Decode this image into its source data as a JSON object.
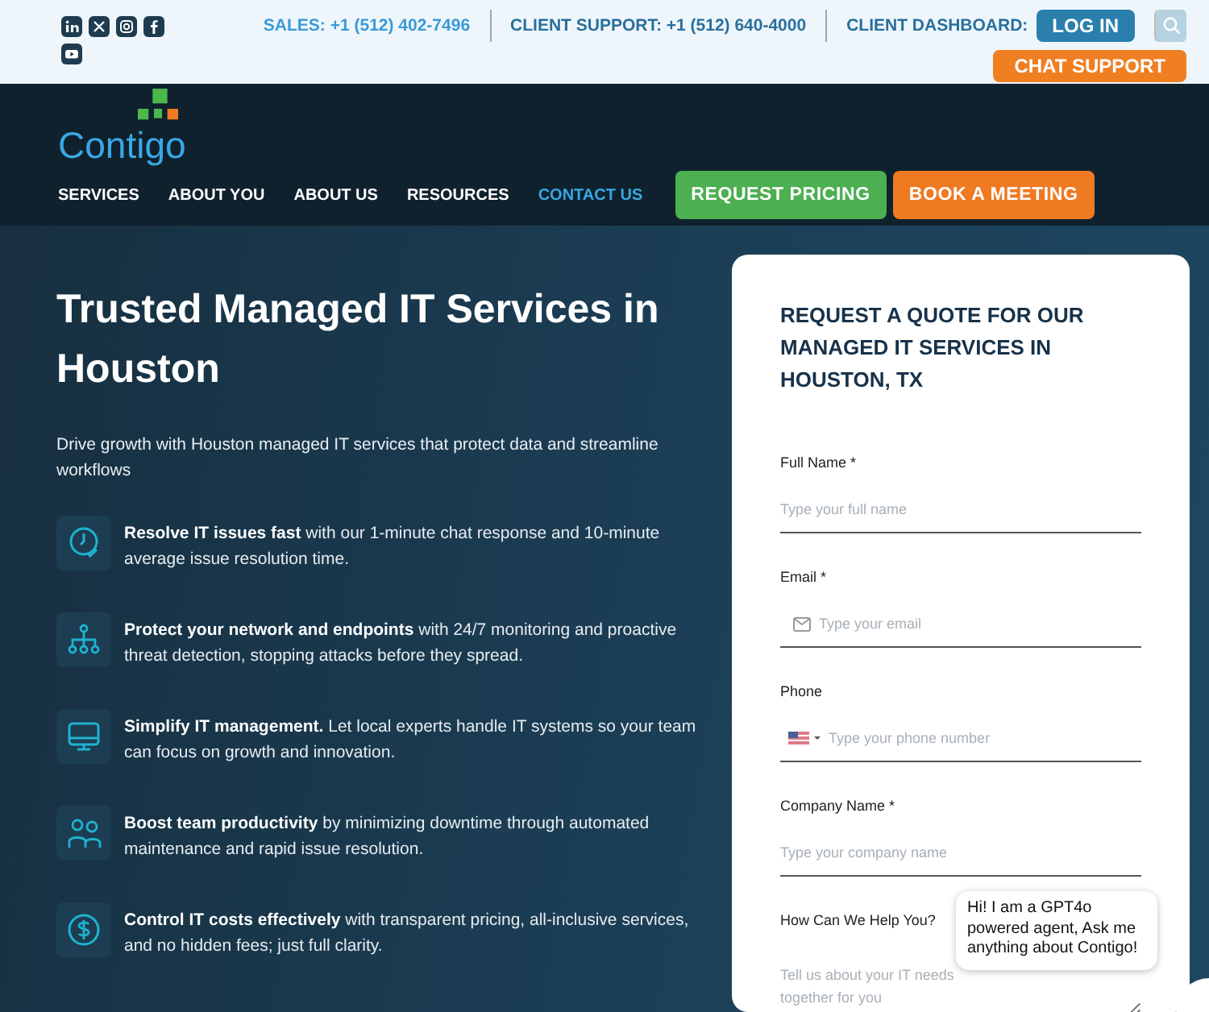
{
  "topbar": {
    "social_icons": [
      {
        "kind": "linkedin"
      },
      {
        "kind": "x"
      },
      {
        "kind": "instagram"
      },
      {
        "kind": "facebook"
      },
      {
        "kind": "youtube"
      }
    ],
    "contacts": [
      {
        "text": "SALES: +1 (512) 402-7496",
        "kind": "sales"
      },
      {
        "text": "CLIENT SUPPORT: +1 (512) 640-4000",
        "kind": "support"
      }
    ],
    "dashboard_label": "CLIENT DASHBOARD:",
    "login_button": "LOG IN",
    "chat_support_button": "CHAT SUPPORT"
  },
  "nav": {
    "logo": "Contigo",
    "items": [
      {
        "label": "SERVICES",
        "selected": false
      },
      {
        "label": "ABOUT YOU",
        "selected": false
      },
      {
        "label": "ABOUT US",
        "selected": false
      },
      {
        "label": "RESOURCES",
        "selected": false
      },
      {
        "label": "CONTACT US",
        "selected": true
      }
    ],
    "buttons": [
      {
        "label": "REQUEST PRICING",
        "kind": "green"
      },
      {
        "label": "BOOK A MEETING",
        "kind": "orange"
      }
    ]
  },
  "hero": {
    "title": "Trusted Managed IT Services in Houston",
    "subtitle": "Drive growth with Houston managed IT services that protect data and streamline workflows",
    "features": [
      {
        "kind": "clock",
        "text": "**Resolve IT issues fast** with our 1-minute chat response and 10-minute average issue resolution time."
      },
      {
        "kind": "network",
        "text": "**Protect your network and endpoints** with 24/7 monitoring and proactive threat detection, stopping attacks before they spread."
      },
      {
        "kind": "monitor",
        "text": "**Simplify IT management.** Let local experts handle IT systems so your team can focus on growth and innovation."
      },
      {
        "kind": "team",
        "text": "**Boost team productivity** by minimizing downtime through automated maintenance and rapid issue resolution."
      },
      {
        "kind": "dollar",
        "text": "**Control IT costs effectively** with transparent pricing, all-inclusive services, and no hidden fees; just full clarity."
      }
    ]
  },
  "form": {
    "title": "REQUEST A QUOTE FOR OUR MANAGED IT SERVICES IN HOUSTON, TX",
    "fields": [
      {
        "kind": "text",
        "label": "Full Name *",
        "placeholder": "Type your full name"
      },
      {
        "kind": "email",
        "label": "Email *",
        "placeholder": "Type your email"
      },
      {
        "kind": "phone",
        "label": "Phone",
        "placeholder": "Type your phone number"
      },
      {
        "kind": "text",
        "label": "Company Name *",
        "placeholder": "Type your company name"
      },
      {
        "kind": "textarea",
        "label": "How Can We Help You?",
        "placeholder": "Tell us about your IT needs together for you"
      }
    ]
  },
  "chat": {
    "message": "Hi! I am a GPT4o powered agent, Ask me anything about Contigo!"
  }
}
